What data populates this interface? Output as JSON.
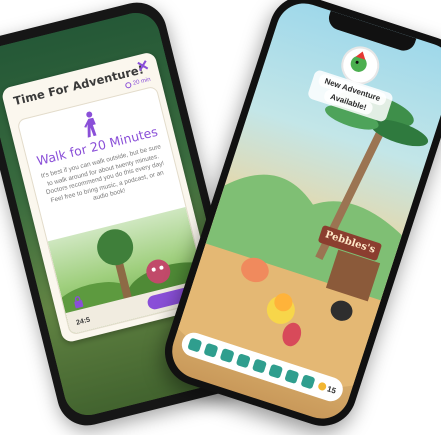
{
  "back_screen": {
    "card_title": "Time For Adventure!",
    "close_symbol": "✕",
    "duration": "20 min",
    "activity_title": "Walk for 20 Minutes",
    "activity_description": "It's best if you can walk outside, but be sure to walk around for about twenty minutes. Doctors recommend you do this every day! Feel free to bring music, a podcast, or an audio book!",
    "timer": "24:5",
    "colors": {
      "accent": "#8a4fd8",
      "card": "#fbf7ee"
    }
  },
  "front_screen": {
    "banner_line1": "New Adventure",
    "banner_line2": "Available!",
    "sign_text": "Pebbles's",
    "coins": "15",
    "toolbar_icons": [
      "flower-icon",
      "boot-icon",
      "heart-icon",
      "sock-icon",
      "shirt-icon",
      "paw-icon",
      "cat-icon",
      "shop-icon"
    ],
    "colors": {
      "toolbar_icon": "#2f9e8e",
      "sign": "#8b3e2f"
    }
  }
}
